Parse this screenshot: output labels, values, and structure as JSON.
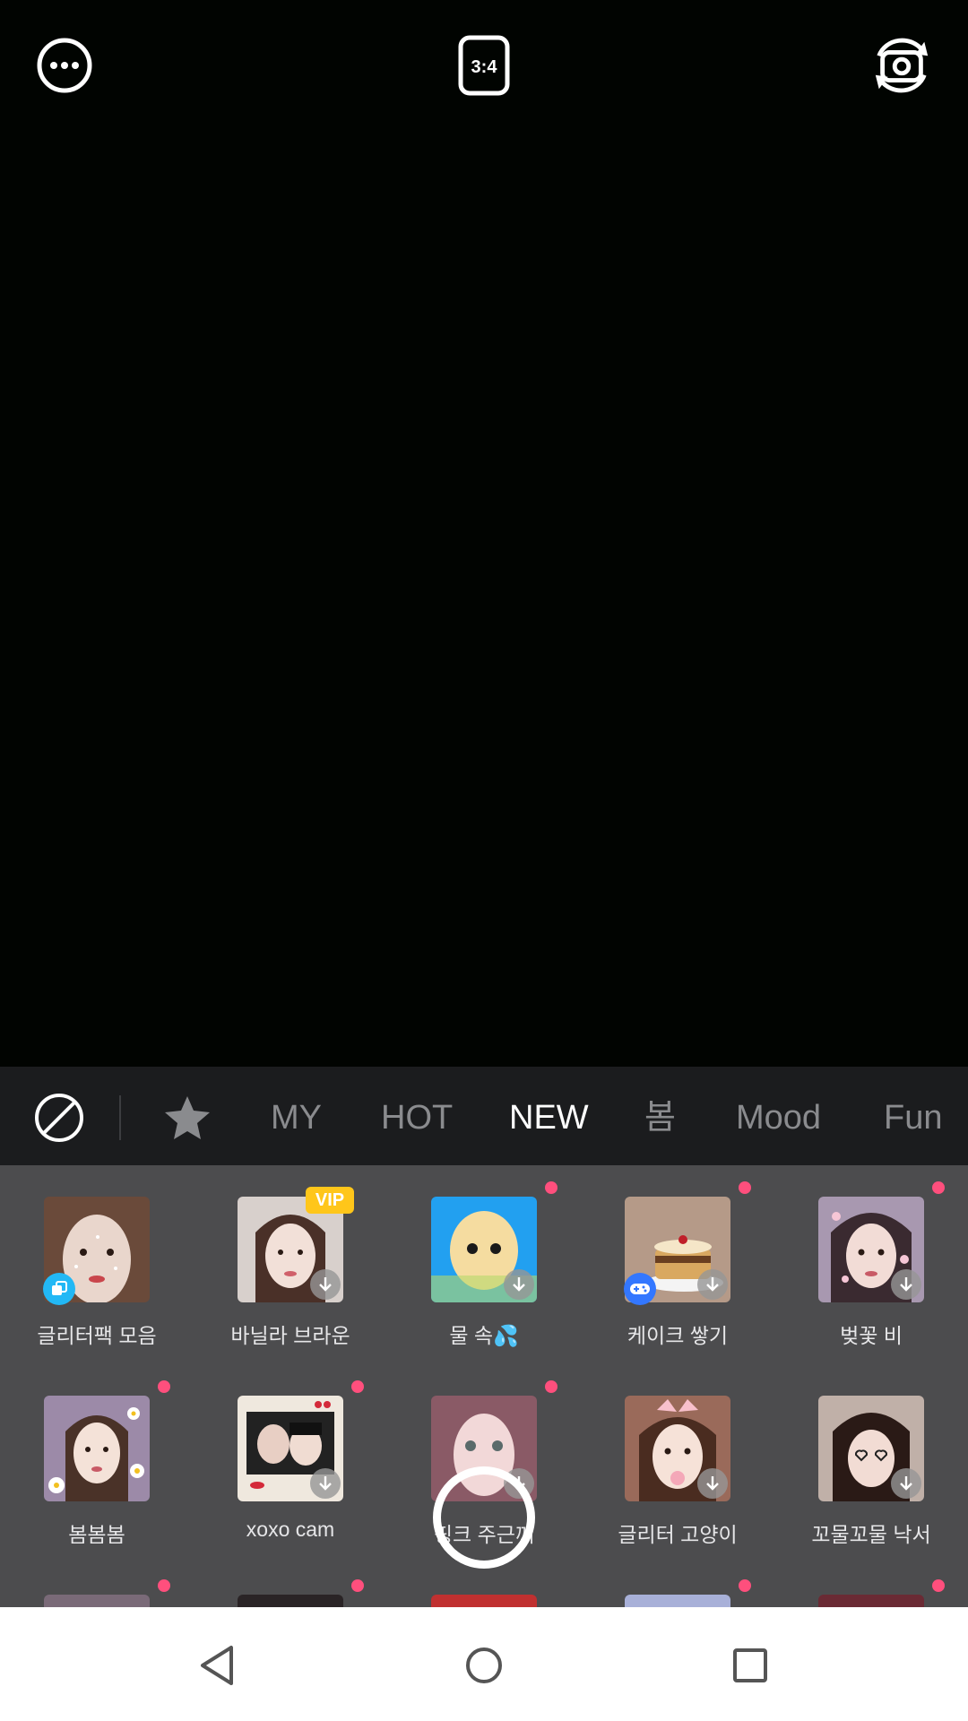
{
  "top_bar": {
    "menu_icon": "more-horizontal-circle-icon",
    "ratio_label": "3:4",
    "flip_icon": "camera-flip-icon"
  },
  "category_bar": {
    "none_icon": "no-filter-icon",
    "favorite_icon": "star-icon",
    "tabs": [
      "MY",
      "HOT",
      "NEW",
      "봄",
      "Mood",
      "Fun"
    ],
    "active_tab": "NEW"
  },
  "effects": [
    {
      "label": "글리터팩 모음",
      "badge": "multi-icon",
      "new": false,
      "download": false
    },
    {
      "label": "바닐라 브라운",
      "badge": "VIP",
      "new": false,
      "download": true
    },
    {
      "label": "물 속💦",
      "new": true,
      "download": true
    },
    {
      "label": "케이크 쌓기",
      "badge": "game-icon",
      "new": true,
      "download": true
    },
    {
      "label": "벚꽃 비",
      "new": true,
      "download": true
    },
    {
      "label": "봄봄봄",
      "new": true,
      "download": true
    },
    {
      "label": "xoxo cam",
      "new": true,
      "download": true
    },
    {
      "label": "핑크 주근깨",
      "new": true,
      "download": true
    },
    {
      "label": "글리터 고양이",
      "new": false,
      "download": true
    },
    {
      "label": "꼬물꼬물 낙서",
      "new": false,
      "download": true
    }
  ],
  "colors": {
    "accent_dot": "#ff4f7d",
    "vip": "#ffc61a",
    "grid_bg": "#4c4c4e",
    "category_bg": "#1b1c1e"
  },
  "nav": {
    "back_icon": "back-triangle-icon",
    "home_icon": "home-circle-icon",
    "recents_icon": "recents-square-icon"
  }
}
